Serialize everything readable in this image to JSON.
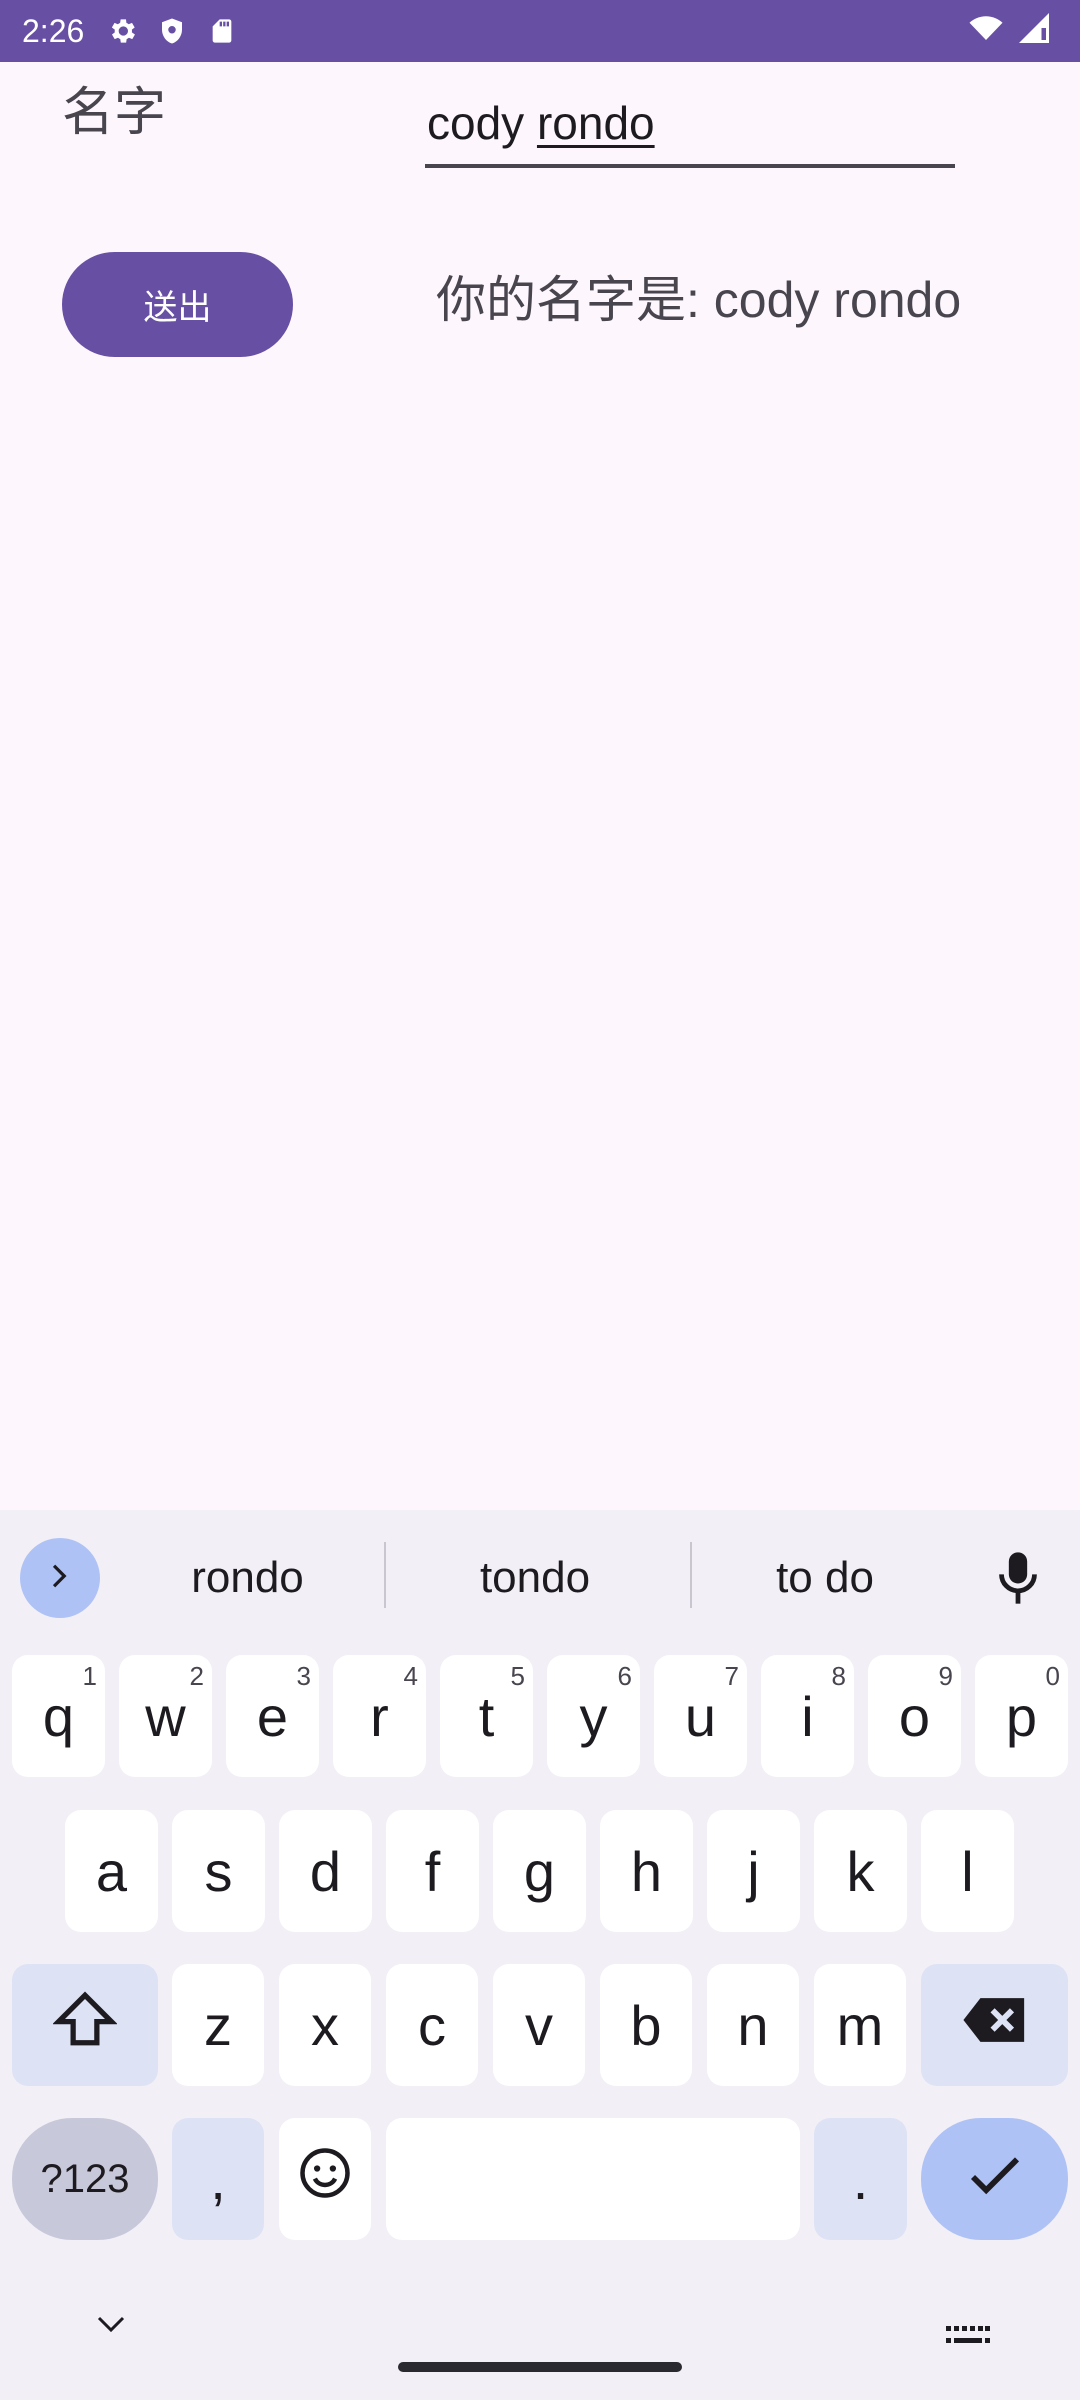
{
  "status_bar": {
    "time": "2:26",
    "bg_color": "#6750a4",
    "icons": [
      "settings-icon",
      "shield-icon",
      "sd-card-icon",
      "wifi-icon",
      "signal-icon"
    ]
  },
  "form": {
    "label": "名字",
    "input_value_committed": "cody ",
    "input_value_composing": "rondo",
    "submit_label": "送出",
    "result_text": "你的名字是: cody rondo"
  },
  "keyboard": {
    "suggestions": [
      "rondo",
      "tondo",
      "to do"
    ],
    "row1": [
      {
        "key": "q",
        "hint": "1"
      },
      {
        "key": "w",
        "hint": "2"
      },
      {
        "key": "e",
        "hint": "3"
      },
      {
        "key": "r",
        "hint": "4"
      },
      {
        "key": "t",
        "hint": "5"
      },
      {
        "key": "y",
        "hint": "6"
      },
      {
        "key": "u",
        "hint": "7"
      },
      {
        "key": "i",
        "hint": "8"
      },
      {
        "key": "o",
        "hint": "9"
      },
      {
        "key": "p",
        "hint": "0"
      }
    ],
    "row2": [
      "a",
      "s",
      "d",
      "f",
      "g",
      "h",
      "j",
      "k",
      "l"
    ],
    "row3": [
      "z",
      "x",
      "c",
      "v",
      "b",
      "n",
      "m"
    ],
    "symbols_label": "?123",
    "comma_label": ",",
    "period_label": ".",
    "accent_color": "#aec2f5"
  }
}
